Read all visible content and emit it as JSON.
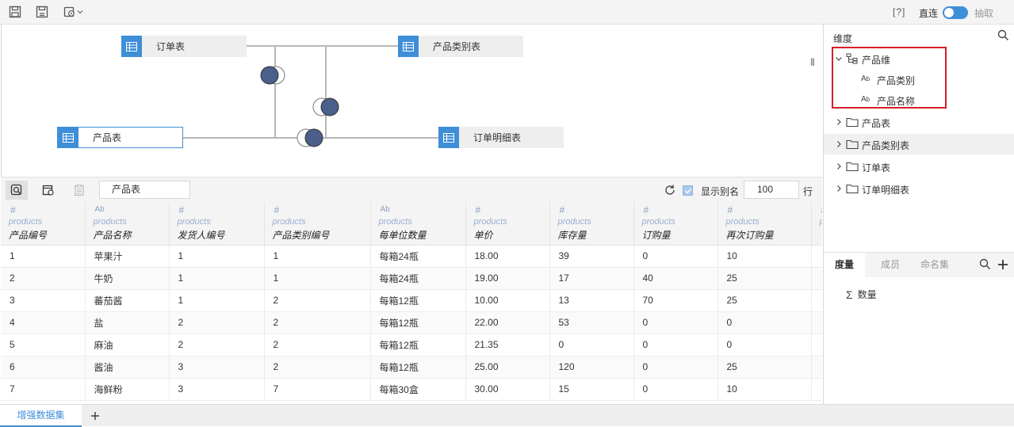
{
  "toolbar": {
    "help_label": "[?]",
    "direct_label": "直连",
    "extract_label": "抽取",
    "icons": [
      "save-icon",
      "save-as-icon",
      "settings-icon",
      "chevron-down-icon"
    ]
  },
  "canvas": {
    "nodes": [
      {
        "label": "订单表"
      },
      {
        "label": "产品类别表"
      },
      {
        "label": "产品表"
      },
      {
        "label": "订单明细表"
      }
    ]
  },
  "gridbar": {
    "current_table": "产品表",
    "show_alias_label": "显示别名",
    "show_alias_checked": true,
    "rows_value": "100",
    "rows_unit": "行"
  },
  "grid": {
    "columns": [
      {
        "type": "#",
        "table": "products",
        "name": "产品编号"
      },
      {
        "type": "Ab",
        "table": "products",
        "name": "产品名称"
      },
      {
        "type": "#",
        "table": "products",
        "name": "发货人编号"
      },
      {
        "type": "#",
        "table": "products",
        "name": "产品类别编号"
      },
      {
        "type": "Ab",
        "table": "products",
        "name": "每单位数量"
      },
      {
        "type": "#",
        "table": "products",
        "name": "单价"
      },
      {
        "type": "#",
        "table": "products",
        "name": "库存量"
      },
      {
        "type": "#",
        "table": "products",
        "name": "订购量"
      },
      {
        "type": "#",
        "table": "products",
        "name": "再次订购量"
      },
      {
        "type": "#",
        "table": "products",
        "name": ""
      }
    ],
    "rows": [
      [
        "1",
        "苹果汁",
        "1",
        "1",
        "每箱24瓶",
        "18.00",
        "39",
        "0",
        "10",
        ""
      ],
      [
        "2",
        "牛奶",
        "1",
        "1",
        "每箱24瓶",
        "19.00",
        "17",
        "40",
        "25",
        ""
      ],
      [
        "3",
        "蕃茄酱",
        "1",
        "2",
        "每箱12瓶",
        "10.00",
        "13",
        "70",
        "25",
        ""
      ],
      [
        "4",
        "盐",
        "2",
        "2",
        "每箱12瓶",
        "22.00",
        "53",
        "0",
        "0",
        ""
      ],
      [
        "5",
        "麻油",
        "2",
        "2",
        "每箱12瓶",
        "21.35",
        "0",
        "0",
        "0",
        ""
      ],
      [
        "6",
        "酱油",
        "3",
        "2",
        "每箱12瓶",
        "25.00",
        "120",
        "0",
        "25",
        ""
      ],
      [
        "7",
        "海鲜粉",
        "3",
        "7",
        "每箱30盒",
        "30.00",
        "15",
        "0",
        "10",
        ""
      ]
    ]
  },
  "dimensions": {
    "title": "维度",
    "items": [
      {
        "label": "产品维",
        "expanded": true
      },
      {
        "label": "产品类别",
        "type": "Ab"
      },
      {
        "label": "产品名称",
        "type": "Ab"
      },
      {
        "label": "产品表"
      },
      {
        "label": "产品类别表"
      },
      {
        "label": "订单表"
      },
      {
        "label": "订单明细表"
      }
    ]
  },
  "measures": {
    "tabs": [
      "度量",
      "成员",
      "命名集"
    ],
    "active_tab": "度量",
    "items": [
      {
        "label": "数量"
      }
    ]
  },
  "bottom": {
    "dataset_tab": "增强数据集",
    "add_label": "+"
  },
  "colors": {
    "accent": "#3e8ed8",
    "highlight_border": "#d2202a",
    "join_fill": "#4a5f8a"
  }
}
